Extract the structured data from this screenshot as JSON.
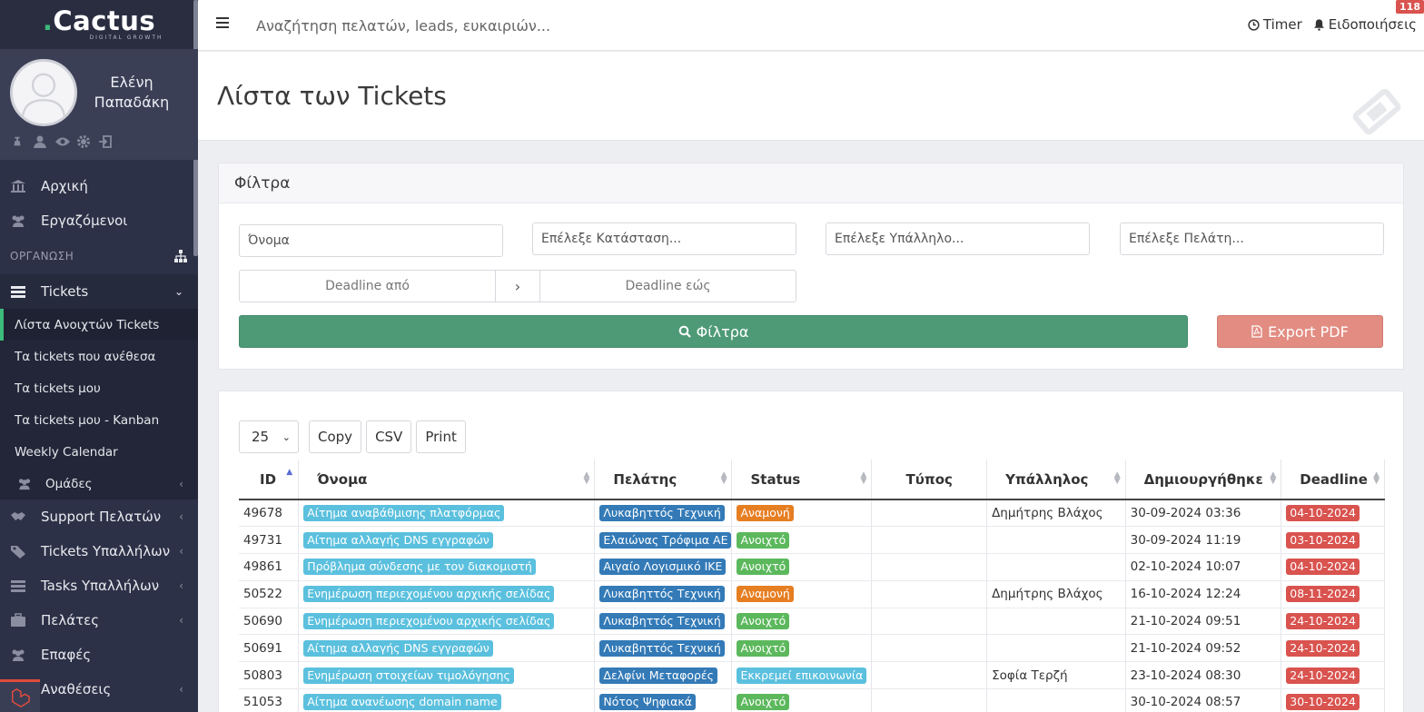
{
  "brand": {
    "name": "Cactus",
    "tagline": "DIGITAL GROWTH"
  },
  "user": {
    "first_name": "Ελένη",
    "last_name": "Παπαδάκη"
  },
  "nav": {
    "home": "Αρχική",
    "employees": "Εργαζόμενοι",
    "section_org": "ΟΡΓΑΝΩΣΗ",
    "tickets": "Tickets",
    "sub": {
      "open_list": "Λίστα Ανοιχτών Tickets",
      "assigned_by_me": "Τα tickets που ανέθεσα",
      "mine": "Τα tickets μου",
      "mine_kanban": "Τα tickets μου - Kanban",
      "weekly": "Weekly Calendar",
      "groups": "Ομάδες"
    },
    "support": "Support Πελατών",
    "emp_tickets": "Tickets Υπαλλήλων",
    "emp_tasks": "Tasks Υπαλλήλων",
    "clients": "Πελάτες",
    "contacts": "Επαφές",
    "assignments": "Αναθέσεις"
  },
  "topbar": {
    "search_placeholder": "Αναζήτηση πελατών, leads, ευκαιριών...",
    "timer": "Timer",
    "notifications": "Ειδοποιήσεις",
    "notif_count": "118"
  },
  "page": {
    "title": "Λίστα των Tickets"
  },
  "filters": {
    "title": "Φίλτρα",
    "name_placeholder": "Όνομα",
    "status_placeholder": "Επέλεξε Κατάσταση...",
    "employee_placeholder": "Επέλεξε Υπάλληλο...",
    "client_placeholder": "Επέλεξε Πελάτη...",
    "deadline_from": "Deadline από",
    "deadline_sep": "›",
    "deadline_to": "Deadline εώς",
    "apply": "Φίλτρα",
    "export": "Export PDF"
  },
  "table": {
    "page_length": "25",
    "buttons": {
      "copy": "Copy",
      "csv": "CSV",
      "print": "Print"
    },
    "columns": {
      "id": "ID",
      "name": "Όνομα",
      "client": "Πελάτης",
      "status": "Status",
      "type": "Τύπος",
      "employee": "Υπάλληλος",
      "created": "Δημιουργήθηκε",
      "deadline": "Deadline"
    },
    "rows": [
      {
        "id": "49678",
        "name": "Αίτημα αναβάθμισης πλατφόρμας",
        "client": "Λυκαβηττός Τεχνική",
        "status": "Αναμονή",
        "status_kind": "warning",
        "type": "",
        "employee": "Δημήτρης Βλάχος",
        "created": "30-09-2024 03:36",
        "deadline": "04-10-2024"
      },
      {
        "id": "49731",
        "name": "Αίτημα αλλαγής DNS εγγραφών",
        "client": "Ελαιώνας Τρόφιμα ΑΕ",
        "status": "Ανοιχτό",
        "status_kind": "success",
        "type": "",
        "employee": "",
        "created": "30-09-2024 11:19",
        "deadline": "03-10-2024"
      },
      {
        "id": "49861",
        "name": "Πρόβλημα σύνδεσης με τον διακομιστή",
        "client": "Αιγαίο Λογισμικό ΙΚΕ",
        "status": "Ανοιχτό",
        "status_kind": "success",
        "type": "",
        "employee": "",
        "created": "02-10-2024 10:07",
        "deadline": "04-10-2024"
      },
      {
        "id": "50522",
        "name": "Ενημέρωση περιεχομένου αρχικής σελίδας",
        "client": "Λυκαβηττός Τεχνική",
        "status": "Αναμονή",
        "status_kind": "warning",
        "type": "",
        "employee": "Δημήτρης Βλάχος",
        "created": "16-10-2024 12:24",
        "deadline": "08-11-2024"
      },
      {
        "id": "50690",
        "name": "Ενημέρωση περιεχομένου αρχικής σελίδας",
        "client": "Λυκαβηττός Τεχνική",
        "status": "Ανοιχτό",
        "status_kind": "success",
        "type": "",
        "employee": "",
        "created": "21-10-2024 09:51",
        "deadline": "24-10-2024"
      },
      {
        "id": "50691",
        "name": "Αίτημα αλλαγής DNS εγγραφών",
        "client": "Λυκαβηττός Τεχνική",
        "status": "Ανοιχτό",
        "status_kind": "success",
        "type": "",
        "employee": "",
        "created": "21-10-2024 09:52",
        "deadline": "24-10-2024"
      },
      {
        "id": "50803",
        "name": "Ενημέρωση στοιχείων τιμολόγησης",
        "client": "Δελφίνι Μεταφορές",
        "status": "Εκκρεμεί επικοινωνία",
        "status_kind": "info",
        "type": "",
        "employee": "Σοφία Τερζή",
        "created": "23-10-2024 08:30",
        "deadline": "24-10-2024"
      },
      {
        "id": "51053",
        "name": "Αίτημα ανανέωσης domain name",
        "client": "Νότος Ψηφιακά",
        "status": "Ανοιχτό",
        "status_kind": "success",
        "type": "",
        "employee": "",
        "created": "30-10-2024 08:57",
        "deadline": "30-10-2024"
      }
    ]
  },
  "colors": {
    "sidebar": "#2d3147",
    "accent_green": "#4e9a77",
    "export_red": "#e28c82"
  }
}
